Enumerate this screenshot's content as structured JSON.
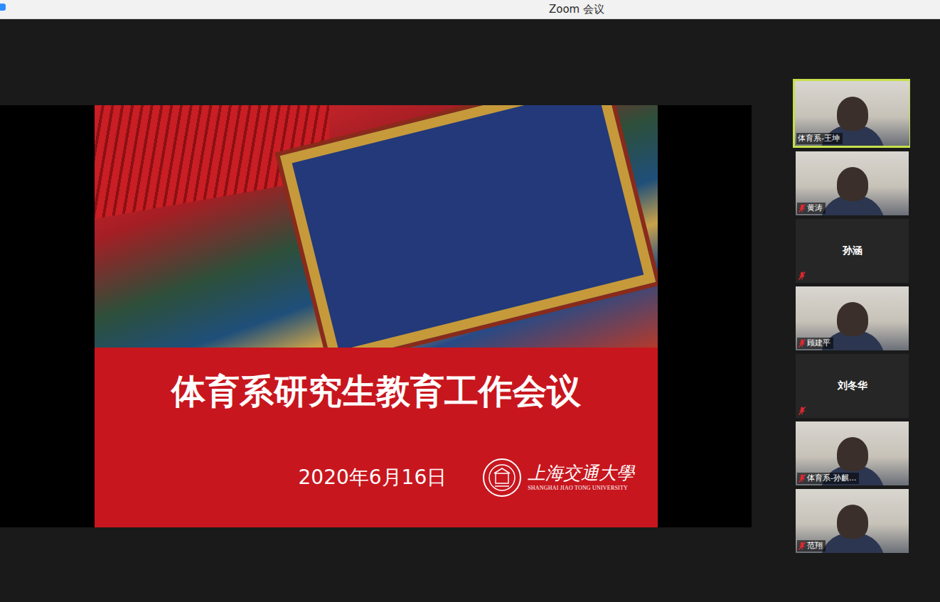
{
  "window": {
    "title": "Zoom 会议"
  },
  "slide": {
    "title": "体育系研究生教育工作会议",
    "date": "2020年6月16日",
    "logo": {
      "name": "上海交通大學",
      "name_en": "SHANGHAI JIAO TONG UNIVERSITY"
    }
  },
  "participants": [
    {
      "name": "体育系-王坤",
      "kind": "video",
      "muted": false,
      "speaking": true
    },
    {
      "name": "黄涛",
      "kind": "video",
      "muted": true,
      "speaking": false
    },
    {
      "name": "孙涵",
      "kind": "avatar",
      "muted": true,
      "speaking": false
    },
    {
      "name": "顾建平",
      "kind": "video",
      "muted": true,
      "speaking": false
    },
    {
      "name": "刘冬华",
      "kind": "avatar",
      "muted": true,
      "speaking": false
    },
    {
      "name": "体育系-孙麒...",
      "kind": "video",
      "muted": true,
      "speaking": false
    },
    {
      "name": "范翔",
      "kind": "video",
      "muted": true,
      "speaking": false
    }
  ]
}
